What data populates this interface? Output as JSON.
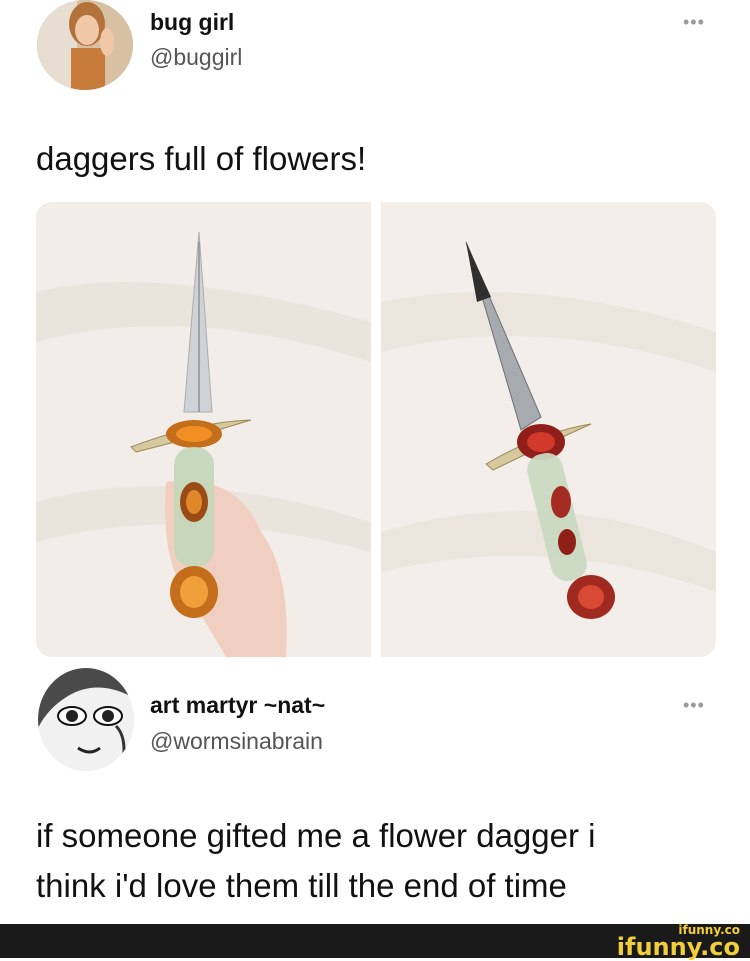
{
  "tweet1": {
    "name": "bug girl",
    "handle": "@buggirl",
    "more": "•••",
    "text": "daggers full of flowers!"
  },
  "tweet2": {
    "name": "art martyr ~nat~",
    "handle": "@wormsinabrain",
    "more": "•••",
    "text_line1": "if someone gifted me a flower dagger i",
    "text_line2": "think i'd love them till the end of time"
  },
  "footer": {
    "brand_small": "ifunny.co",
    "brand_large": "ifunny.co",
    "brand_color": "#f2cf3a"
  }
}
